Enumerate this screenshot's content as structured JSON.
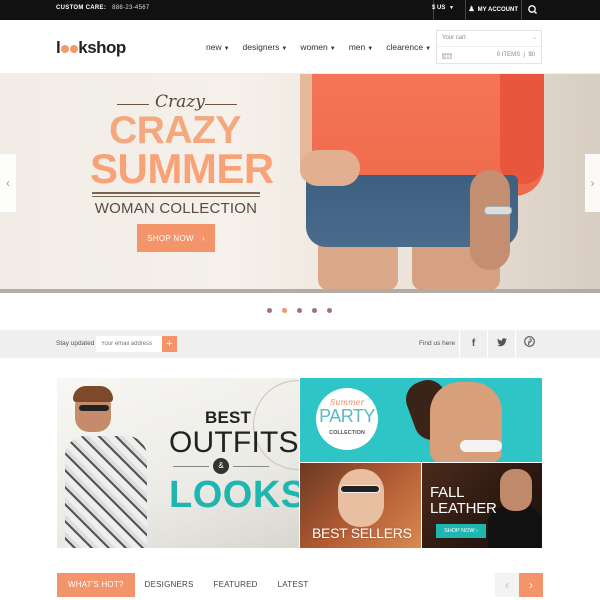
{
  "topbar": {
    "care_label": "CUSTOM CARE:",
    "phone": "888-23-4567",
    "currency": "$ US",
    "account": "MY ACCOUNT"
  },
  "header": {
    "logo": {
      "pre": "l",
      "post": "kshop"
    },
    "nav": [
      {
        "label": "new"
      },
      {
        "label": "designers"
      },
      {
        "label": "women"
      },
      {
        "label": "men"
      },
      {
        "label": "clearence"
      }
    ],
    "cart": {
      "label": "Your cart",
      "items": "0 ITEMS",
      "total": "$0"
    }
  },
  "hero": {
    "script_text": "Crazy",
    "headline_1": "CRAZY",
    "headline_2": "SUMMER",
    "subheadline": "WOMAN COLLECTION",
    "cta": "SHOP NOW",
    "slides": 5,
    "active_slide": 2
  },
  "newsletter": {
    "label": "Stay updated",
    "placeholder": "Your email address",
    "submit": "+",
    "find_us": "Find us here"
  },
  "social": [
    "f",
    "t",
    "p"
  ],
  "promos": {
    "outfits": {
      "line1": "BEST",
      "line2": "OUTFITS",
      "amp": "&",
      "line3": "LOOKS"
    },
    "party": {
      "script": "Summer",
      "word": "PARTY",
      "sub": "COLLECTION"
    },
    "bestsellers": {
      "label": "BEST SELLERS"
    },
    "leather": {
      "line1": "FALL",
      "line2": "LEATHER",
      "cta": "SHOP NOW"
    }
  },
  "tabs": [
    {
      "label": "WHAT'S HOT?",
      "active": true
    },
    {
      "label": "DESIGNERS"
    },
    {
      "label": "FEATURED"
    },
    {
      "label": "LATEST"
    }
  ],
  "colors": {
    "accent": "#f4946a",
    "teal": "#1fb6b0",
    "dark": "#111111"
  }
}
